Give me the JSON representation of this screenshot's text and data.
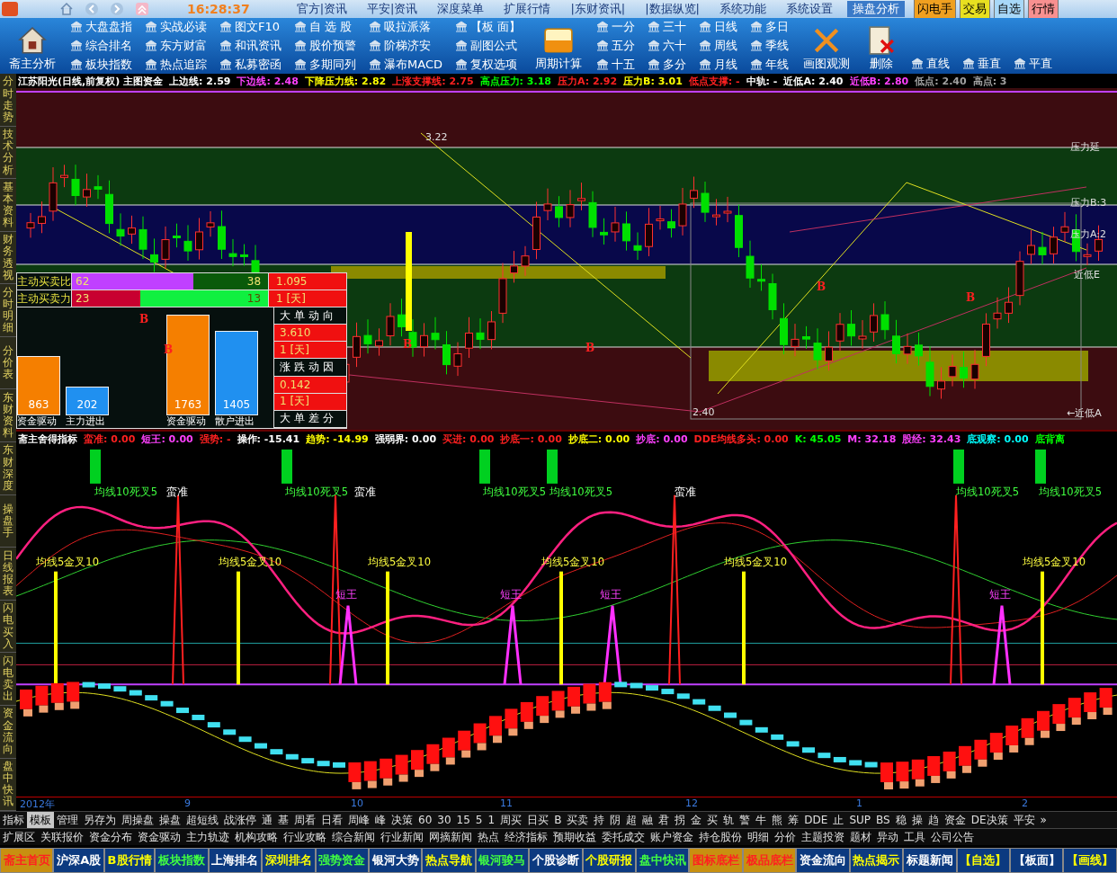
{
  "top_menu": {
    "time": "16:28:37",
    "items": [
      {
        "text": "官方|资讯",
        "selected": false
      },
      {
        "text": "平安|资讯",
        "selected": false
      },
      {
        "text": "深度菜单",
        "selected": false
      },
      {
        "text": "扩展行情",
        "selected": false
      },
      {
        "text": "|东财资讯|",
        "selected": false
      },
      {
        "text": "|数据纵览|",
        "selected": false
      },
      {
        "text": "系统功能",
        "selected": false
      },
      {
        "text": "系统设置",
        "selected": false
      },
      {
        "text": "操盘分析",
        "selected": true
      }
    ],
    "quick_buttons": [
      {
        "text": "闪电手",
        "color": "#f0a020"
      },
      {
        "text": "交易",
        "color": "#e8e020"
      },
      {
        "text": "自选",
        "color": "#a8d8f8"
      },
      {
        "text": "行情",
        "color": "#f89090"
      }
    ]
  },
  "toolbar": {
    "groups": [
      {
        "kind": "big",
        "label": "斋主分析"
      },
      {
        "kind": "column",
        "items": [
          "大盘盘指",
          "综合排名",
          "板块指数"
        ]
      },
      {
        "kind": "column",
        "items": [
          "实战必读",
          "东方财富",
          "热点追踪"
        ]
      },
      {
        "kind": "column",
        "items": [
          "图文F10",
          "和讯资讯",
          "私募密函"
        ]
      },
      {
        "kind": "column",
        "items": [
          "自 选 股",
          "股价预警",
          "多期同列"
        ]
      },
      {
        "kind": "column",
        "items": [
          "吸拉派落",
          "阶梯济安",
          "瀑布MACD"
        ]
      },
      {
        "kind": "column",
        "items": [
          "【板 面】",
          "副图公式",
          "复权选项"
        ]
      },
      {
        "kind": "big",
        "label": "周期计算"
      },
      {
        "kind": "column",
        "items": [
          "一分",
          "五分",
          "十五"
        ]
      },
      {
        "kind": "column",
        "items": [
          "三十",
          "六十",
          "多分"
        ]
      },
      {
        "kind": "column",
        "items": [
          "日线",
          "周线",
          "月线"
        ]
      },
      {
        "kind": "column",
        "items": [
          "多日",
          "季线",
          "年线"
        ]
      },
      {
        "kind": "big",
        "label": "画图观测"
      },
      {
        "kind": "big",
        "label": "删除"
      },
      {
        "kind": "single",
        "items": [
          "直线"
        ]
      },
      {
        "kind": "single",
        "items": [
          "垂直"
        ]
      },
      {
        "kind": "single",
        "items": [
          "平直"
        ]
      }
    ]
  },
  "side_tabs": [
    "分时走势",
    "技术分析",
    "基本资料",
    "财务透视",
    "分时明细",
    "分价表",
    "东财资料",
    "东财深度",
    "操盘手",
    "日线报表",
    "闪电买入",
    "闪电卖出",
    "资金流向",
    "盘中快讯"
  ],
  "main_chart": {
    "header": [
      {
        "text": "江苏阳光(日线,前复权) 主图资金",
        "color": "#ffffff"
      },
      {
        "text": "上边线: 2.59",
        "color": "#ffffff"
      },
      {
        "text": "下边线: 2.48",
        "color": "#ff40ff"
      },
      {
        "text": "下降压力线: 2.82",
        "color": "#ffff00"
      },
      {
        "text": "上涨支撑线: 2.75",
        "color": "#ff2020"
      },
      {
        "text": "高点压力: 3.18",
        "color": "#00ff00"
      },
      {
        "text": "压力A: 2.92",
        "color": "#ff2020"
      },
      {
        "text": "压力B: 3.01",
        "color": "#ffff00"
      },
      {
        "text": "低点支撑: -",
        "color": "#ff2020"
      },
      {
        "text": "中轨: -",
        "color": "#ffffff"
      },
      {
        "text": "近低A: 2.40",
        "color": "#ffffff"
      },
      {
        "text": "近低B: 2.80",
        "color": "#ff40ff"
      },
      {
        "text": "低点: 2.40",
        "color": "#a0a0a0"
      },
      {
        "text": "高点: 3",
        "color": "#a0a0a0"
      }
    ],
    "labels": [
      "3.22",
      "2.40",
      "压力延",
      "压力B:3",
      "压力A:2",
      "近低E",
      "←近低A"
    ],
    "buy_marks": [
      "B",
      "B",
      "B",
      "B",
      "B",
      "B"
    ]
  },
  "flow_panel": {
    "ratio_rows": [
      {
        "label": "主动买卖比",
        "value": "1.095",
        "level": 0.62,
        "segments": [
          {
            "text": "62",
            "color": "#c040ff"
          },
          {
            "text": "38",
            "color": "#0a5a0a"
          }
        ]
      },
      {
        "label": "主动买卖力",
        "value": "1 [天]",
        "level": 0.35,
        "segments": [
          {
            "text": "23",
            "color": "#c80030"
          },
          {
            "text": "13",
            "color": "#10f040"
          }
        ]
      }
    ],
    "bars": [
      {
        "value": "863",
        "label": "资金驱动",
        "color": "#f57f00"
      },
      {
        "value": "202",
        "label": "主力进出",
        "color": "#2090f0"
      },
      {
        "value": "1763",
        "label": "资金驱动",
        "color": "#f57f00"
      },
      {
        "value": "1405",
        "label": "散户进出",
        "color": "#2090f0"
      }
    ],
    "side_cells": [
      {
        "text": "大单动向",
        "kind": "heading"
      },
      {
        "text": "3.610",
        "kind": "value"
      },
      {
        "text": "1 [天]",
        "kind": "value"
      },
      {
        "text": "涨跌动因",
        "kind": "heading"
      },
      {
        "text": "0.142",
        "kind": "value"
      },
      {
        "text": "1 [天]",
        "kind": "value"
      },
      {
        "text": "大单差分",
        "kind": "heading"
      }
    ]
  },
  "indicator_chart": {
    "header": [
      {
        "text": "斋主舍得指标",
        "color": "#ffffff"
      },
      {
        "text": "蛮准: 0.00",
        "color": "#ff2020"
      },
      {
        "text": "短王: 0.00",
        "color": "#ff40ff"
      },
      {
        "text": "强势: -",
        "color": "#ff2020"
      },
      {
        "text": "操作: -15.41",
        "color": "#ffffff"
      },
      {
        "text": "趋势: -14.99",
        "color": "#ffff00"
      },
      {
        "text": "强弱界: 0.00",
        "color": "#ffffff"
      },
      {
        "text": "买进: 0.00",
        "color": "#ff2020"
      },
      {
        "text": "抄底一: 0.00",
        "color": "#ff2020"
      },
      {
        "text": "抄底二: 0.00",
        "color": "#ffff00"
      },
      {
        "text": "抄底: 0.00",
        "color": "#ff40ff"
      },
      {
        "text": "DDE均线多头: 0.00",
        "color": "#ff2020"
      },
      {
        "text": "K: 45.05",
        "color": "#00ff00"
      },
      {
        "text": "M: 32.18",
        "color": "#ff40ff"
      },
      {
        "text": "股经: 32.43",
        "color": "#ff40ff"
      },
      {
        "text": "底观察: 0.00",
        "color": "#00ffff"
      },
      {
        "text": "底背离",
        "color": "#00ff00"
      }
    ],
    "death_cross_labels": [
      "均线10死叉5",
      "均线10死叉5",
      "均线10死叉5",
      "均线10死叉5",
      "均线10死叉5",
      "均线10死叉5"
    ],
    "sharp_labels": [
      "蛮准",
      "蛮准",
      "蛮准"
    ],
    "golden_cross_labels": [
      "均线5金叉10",
      "均线5金叉10",
      "均线5金叉10",
      "均线5金叉10",
      "均线5金叉10",
      "均线5金叉10"
    ],
    "king_labels": [
      "短王",
      "短王",
      "短王",
      "短王"
    ]
  },
  "date_axis": [
    "2012年",
    "9",
    "10",
    "11",
    "12",
    "1",
    "2"
  ],
  "indicator_tabs": [
    {
      "text": "指标",
      "selected": false
    },
    {
      "text": "模板",
      "selected": true
    },
    {
      "text": "管理",
      "selected": false
    },
    {
      "text": "另存为",
      "selected": false
    },
    {
      "text": "周操盘",
      "selected": false
    },
    {
      "text": "操盘",
      "selected": false
    },
    {
      "text": "超短线",
      "selected": false
    },
    {
      "text": "战涨停",
      "selected": false
    },
    {
      "text": "通",
      "selected": false
    },
    {
      "text": "基",
      "selected": false
    },
    {
      "text": "周看",
      "selected": false
    },
    {
      "text": "日看",
      "selected": false
    },
    {
      "text": "周峰",
      "selected": false
    },
    {
      "text": "峰",
      "selected": false
    },
    {
      "text": "决策",
      "selected": false
    },
    {
      "text": "60",
      "selected": false
    },
    {
      "text": "30",
      "selected": false
    },
    {
      "text": "15",
      "selected": false
    },
    {
      "text": "5",
      "selected": false
    },
    {
      "text": "1",
      "selected": false
    },
    {
      "text": "周买",
      "selected": false
    },
    {
      "text": "日买",
      "selected": false
    },
    {
      "text": "B",
      "selected": false
    },
    {
      "text": "买卖",
      "selected": false
    },
    {
      "text": "持",
      "selected": false
    },
    {
      "text": "阴",
      "selected": false
    },
    {
      "text": "超",
      "selected": false
    },
    {
      "text": "融",
      "selected": false
    },
    {
      "text": "君",
      "selected": false
    },
    {
      "text": "拐",
      "selected": false
    },
    {
      "text": "金",
      "selected": false
    },
    {
      "text": "买",
      "selected": false
    },
    {
      "text": "轨",
      "selected": false
    },
    {
      "text": "警",
      "selected": false
    },
    {
      "text": "牛",
      "selected": false
    },
    {
      "text": "熊",
      "selected": false
    },
    {
      "text": "筹",
      "selected": false
    },
    {
      "text": "DDE",
      "selected": false
    },
    {
      "text": "止",
      "selected": false
    },
    {
      "text": "SUP",
      "selected": false
    },
    {
      "text": "BS",
      "selected": false
    },
    {
      "text": "稳",
      "selected": false
    },
    {
      "text": "操",
      "selected": false
    },
    {
      "text": "趋",
      "selected": false
    },
    {
      "text": "资金",
      "selected": false
    },
    {
      "text": "DE决策",
      "selected": false
    },
    {
      "text": "平安",
      "selected": false
    },
    {
      "text": "»",
      "selected": false
    }
  ],
  "info_tabs": [
    "扩展区",
    "关联报价",
    "资金分布",
    "资金驱动",
    "主力轨迹",
    "机构攻略",
    "行业攻略",
    "综合新闻",
    "行业新闻",
    "网摘新闻",
    "热点",
    "经济指标",
    "预期收益",
    "委托成交",
    "账户资金",
    "持仓股份",
    "明细",
    "分价",
    "主题投资",
    "题材",
    "异动",
    "工具",
    "公司公告"
  ],
  "bottom_buttons": [
    {
      "text": "斋主首页",
      "color": "#ff2020",
      "kind": "gold"
    },
    {
      "text": "沪深A股",
      "color": "#ffffff",
      "kind": "blue"
    },
    {
      "text": "B股行情",
      "color": "#ffff00",
      "kind": "blue"
    },
    {
      "text": "板块指数",
      "color": "#40ff40",
      "kind": "blue"
    },
    {
      "text": "上海排名",
      "color": "#ffffff",
      "kind": "blue"
    },
    {
      "text": "深圳排名",
      "color": "#ffff00",
      "kind": "blue"
    },
    {
      "text": "强势资金",
      "color": "#40ff40",
      "kind": "blue"
    },
    {
      "text": "银河大势",
      "color": "#ffffff",
      "kind": "blue"
    },
    {
      "text": "热点导航",
      "color": "#ffff00",
      "kind": "blue"
    },
    {
      "text": "银河骏马",
      "color": "#40ff40",
      "kind": "blue"
    },
    {
      "text": "个股诊断",
      "color": "#ffffff",
      "kind": "blue"
    },
    {
      "text": "个股研报",
      "color": "#ffff00",
      "kind": "blue"
    },
    {
      "text": "盘中快讯",
      "color": "#40ff40",
      "kind": "blue"
    },
    {
      "text": "图标底栏",
      "color": "#ff2020",
      "kind": "gold"
    },
    {
      "text": "极品底栏",
      "color": "#ff2020",
      "kind": "gold"
    },
    {
      "text": "资金流向",
      "color": "#ffffff",
      "kind": "blue"
    },
    {
      "text": "热点揭示",
      "color": "#ffff00",
      "kind": "blue"
    },
    {
      "text": "标题新闻",
      "color": "#ffffff",
      "kind": "blue"
    },
    {
      "text": "【自选】",
      "color": "#ffff00",
      "kind": "blue"
    },
    {
      "text": "【板面】",
      "color": "#ffffff",
      "kind": "blue"
    },
    {
      "text": "【画线】",
      "color": "#ffff00",
      "kind": "blue"
    }
  ]
}
